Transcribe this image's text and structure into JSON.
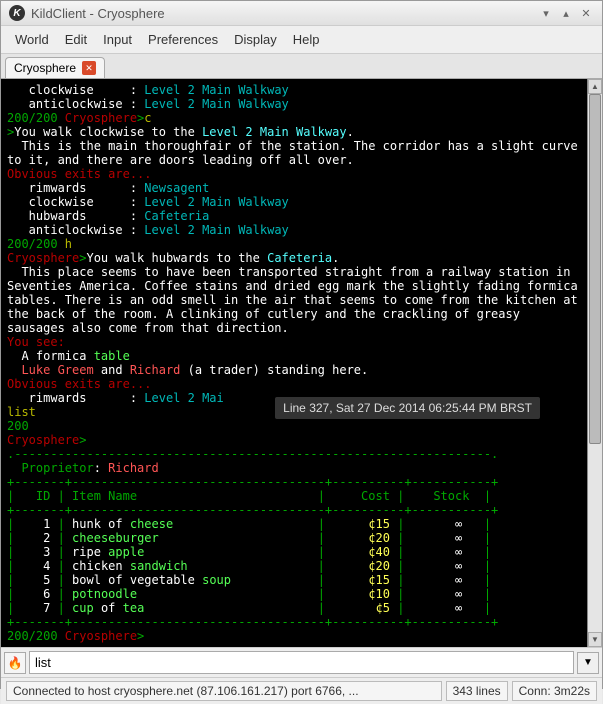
{
  "window": {
    "title": "KildClient - Cryosphere"
  },
  "menu": {
    "m0": "World",
    "m1": "Edit",
    "m2": "Input",
    "m3": "Preferences",
    "m4": "Display",
    "m5": "Help"
  },
  "tab": {
    "label": "Cryosphere"
  },
  "tooltip": "Line 327, Sat 27 Dec 2014 06:25:44 PM BRST",
  "input": {
    "value": "list"
  },
  "status": {
    "conn": "Connected to host cryosphere.net (87.106.161.217) port 6766, ...",
    "lines": "343 lines",
    "time": "Conn: 3m22s"
  },
  "t": {
    "l1a": "   clockwise     : ",
    "l1b": "Level 2 Main Walkway",
    "l2a": "   anticlockwise : ",
    "l2b": "Level 2 Main Walkway",
    "l3a": "200/200 ",
    "l3b": "Cryosphere",
    "l3c": ">",
    "l3d": "c",
    "l4a": ">",
    "l4b": "You walk clockwise to the ",
    "l4c": "Level 2 Main Walkway",
    "l4d": ".",
    "l5": "  This is the main thoroughfair of the station. The corridor has a slight curve",
    "l6": "to it, and there are doors leading off all over.",
    "l7": "Obvious exits are...",
    "l8a": "   rimwards      : ",
    "l8b": "Newsagent",
    "l9a": "   clockwise     : ",
    "l9b": "Level 2 Main Walkway",
    "l10a": "   hubwards      : ",
    "l10b": "Cafeteria",
    "l11a": "   anticlockwise : ",
    "l11b": "Level 2 Main Walkway",
    "l12a": "200/200 ",
    "l12b": "h",
    "l13a": "Cryosphere",
    "l13b": ">",
    "l13c": "You walk hubwards to the ",
    "l13d": "Cafeteria",
    "l13e": ".",
    "l14": "  This place seems to have been transported straight from a railway station in",
    "l15": "Seventies America. Coffee stains and dried egg mark the slightly fading formica",
    "l16": "tables. There is an odd smell in the air that seems to come from the kitchen at",
    "l17": "the back of the room. A clinking of cutlery and the crackling of greasy",
    "l18": "sausages also come from that direction.",
    "l19": "You see:",
    "l20a": "  A formica ",
    "l20b": "table",
    "l21a": "  ",
    "l21b": "Luke Greem",
    "l21c": " and ",
    "l21d": "Richard",
    "l21e": " (a trader) standing here.",
    "l22": "Obvious exits are...",
    "l23a": "   rimwards      : ",
    "l23b": "Level 2 Mai",
    "l24a": "list",
    "l25a": "200",
    "l26a": "Cryosphere",
    "l26b": ">",
    "l27a": "  Proprietor",
    "l27b": ": ",
    "l27c": "Richard",
    "hdr_id": "ID",
    "hdr_name": "Item Name",
    "hdr_cost": "Cost",
    "hdr_stock": "Stock",
    "r1_id": "1",
    "r1_a": "hunk of ",
    "r1_b": "cheese",
    "r1_cost": "¢15",
    "r1_stk": "∞",
    "r2_id": "2",
    "r2_a": "cheeseburger",
    "r2_cost": "¢20",
    "r2_stk": "∞",
    "r3_id": "3",
    "r3_a": "ripe ",
    "r3_b": "apple",
    "r3_cost": "¢40",
    "r3_stk": "∞",
    "r4_id": "4",
    "r4_a": "chicken ",
    "r4_b": "sandwich",
    "r4_cost": "¢20",
    "r4_stk": "∞",
    "r5_id": "5",
    "r5_a": "bowl of vegetable ",
    "r5_b": "soup",
    "r5_cost": "¢15",
    "r5_stk": "∞",
    "r6_id": "6",
    "r6_a": "potnoodle",
    "r6_cost": "¢10",
    "r6_stk": "∞",
    "r7_id": "7",
    "r7_a": "cup",
    "r7_b": " of ",
    "r7_c": "tea",
    "r7_cost": "¢5",
    "r7_stk": "∞",
    "bot_a": "200/200 ",
    "bot_b": "Cryosphere",
    "bot_c": ">"
  }
}
